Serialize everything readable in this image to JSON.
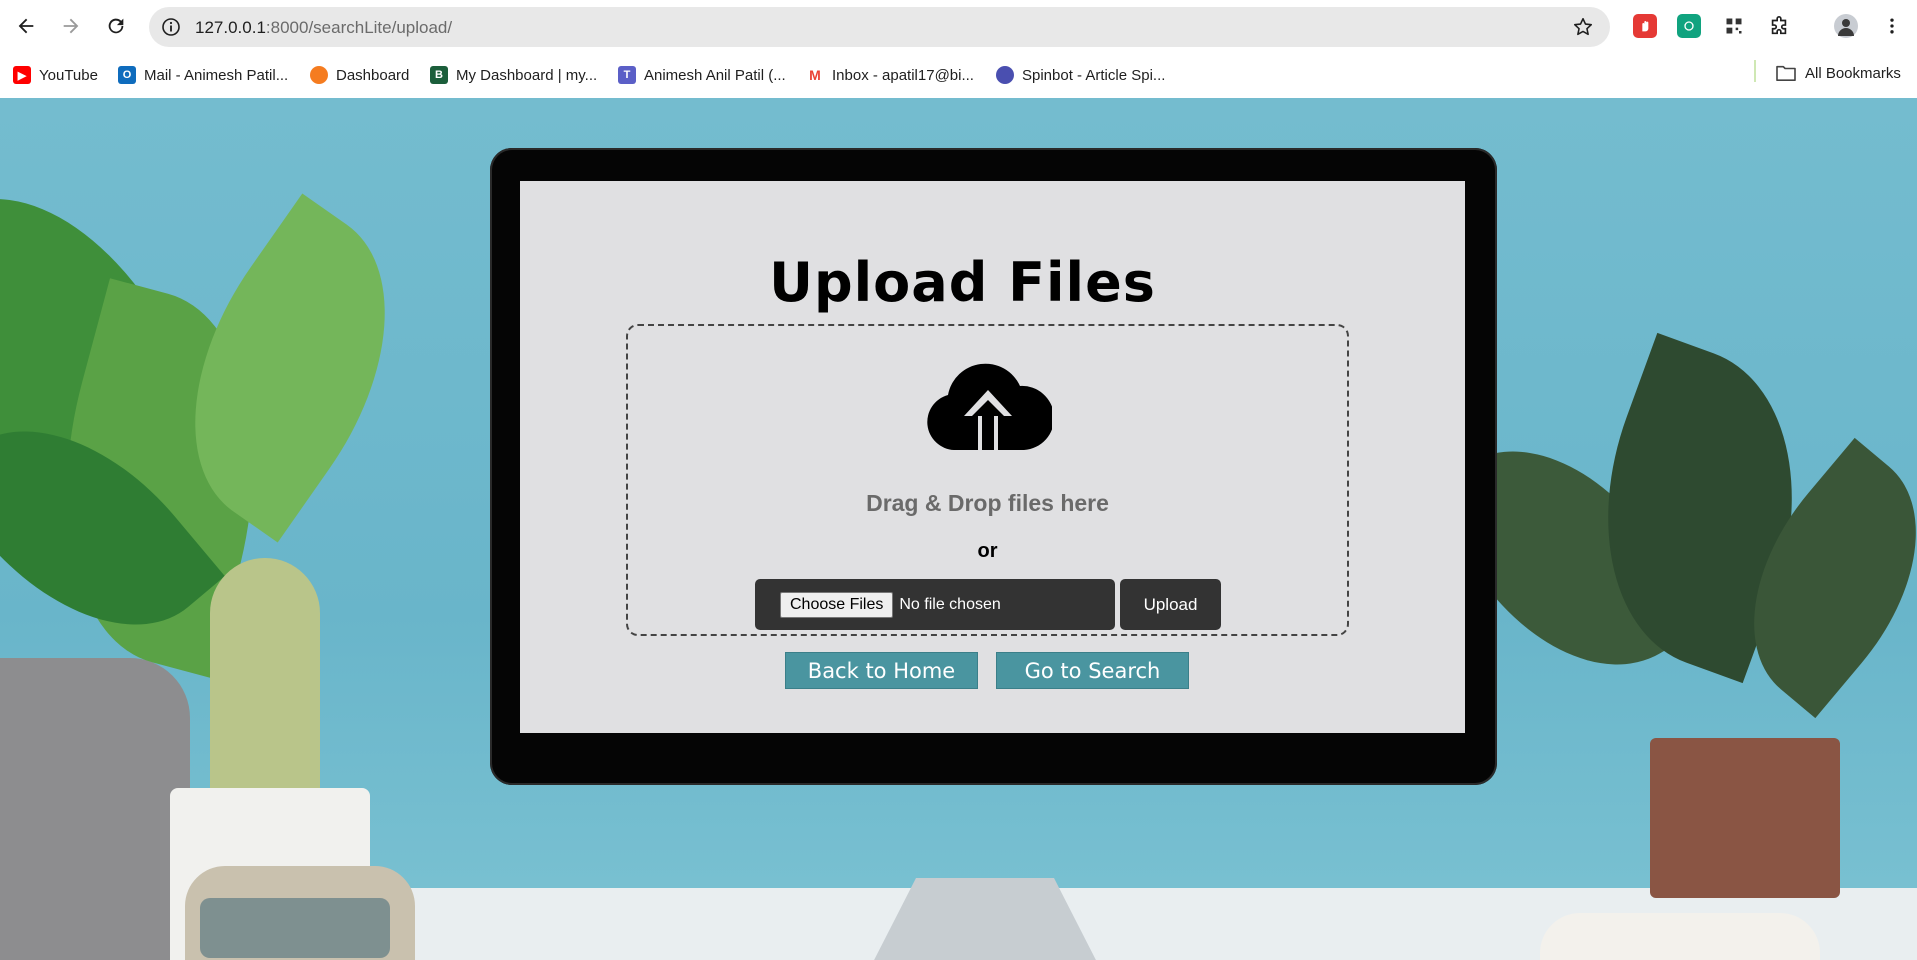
{
  "browser": {
    "url_host": "127.0.0.1",
    "url_rest": ":8000/searchLite/upload/",
    "bookmarks": [
      {
        "label": "YouTube",
        "icon": "youtube-icon",
        "color": "#ff0000"
      },
      {
        "label": "Mail - Animesh Patil...",
        "icon": "outlook-icon",
        "color": "#0f6cbd"
      },
      {
        "label": "Dashboard",
        "icon": "dashboard-icon",
        "color": "#f57c20"
      },
      {
        "label": "My Dashboard | my...",
        "icon": "b-logo-icon",
        "color": "#1b5e3b"
      },
      {
        "label": "Animesh Anil Patil (...",
        "icon": "teams-icon",
        "color": "#5b5fc7"
      },
      {
        "label": "Inbox - apatil17@bi...",
        "icon": "gmail-icon",
        "color": "#ea4335"
      },
      {
        "label": "Spinbot - Article Spi...",
        "icon": "spinbot-icon",
        "color": "#4a4fb0"
      }
    ],
    "all_bookmarks": "All Bookmarks"
  },
  "page": {
    "title": "Upload Files",
    "drag_text": "Drag & Drop files here",
    "or_text": "or",
    "choose_files": "Choose Files",
    "no_file": "No file chosen",
    "upload": "Upload",
    "back_home": "Back to Home",
    "go_search": "Go to Search"
  },
  "colors": {
    "accent_button": "#4a95a0",
    "dark_button": "#333333",
    "screen_bg": "#e0e0e2"
  }
}
